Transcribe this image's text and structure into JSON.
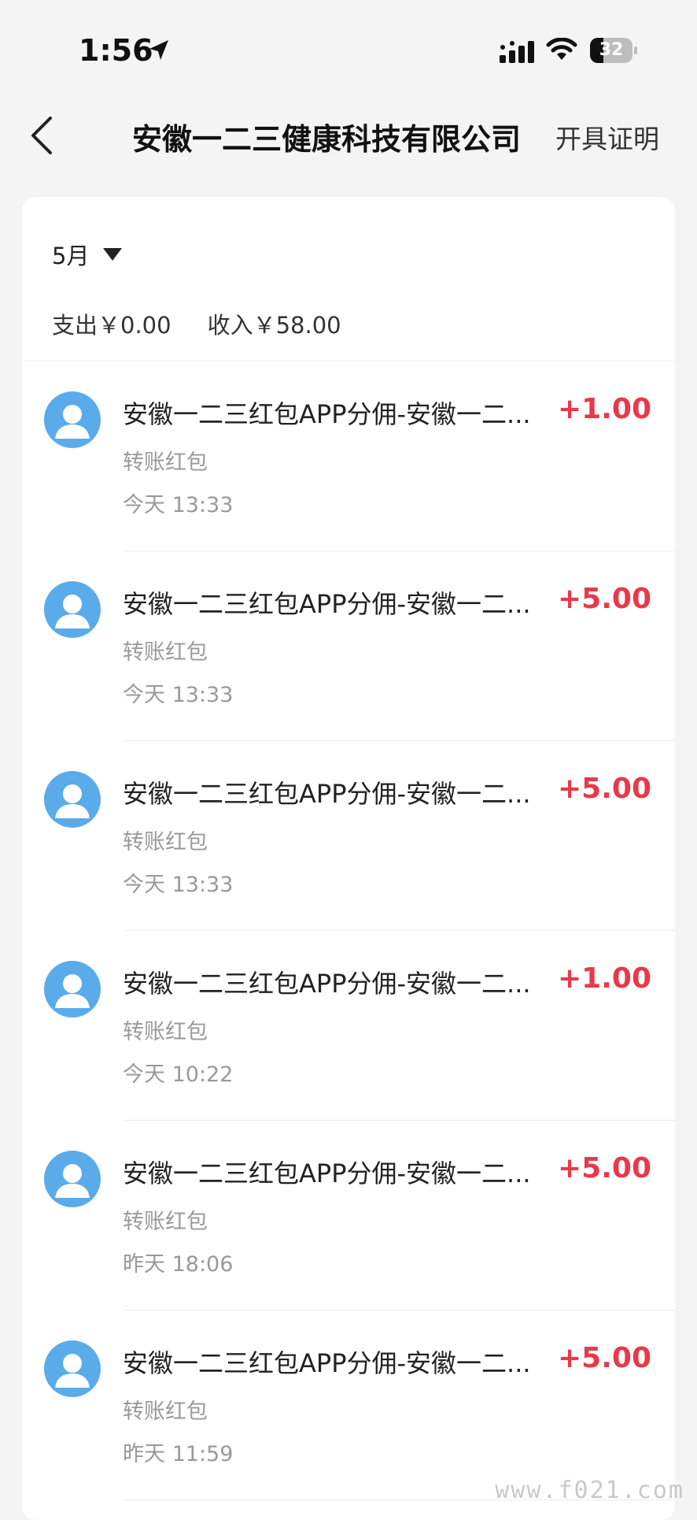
{
  "status_bar": {
    "time": "1:56",
    "battery_level": "32",
    "icons": [
      "location-arrow-icon",
      "cellular-signal-icon",
      "wifi-icon",
      "battery-icon"
    ]
  },
  "nav": {
    "back_icon": "chevron-left-icon",
    "title": "安徽一二三健康科技有限公司",
    "action": "开具证明"
  },
  "filter": {
    "month": "5月",
    "icon": "caret-down-icon"
  },
  "summary": {
    "expense": "支出￥0.00",
    "income": "收入￥58.00"
  },
  "transactions": [
    {
      "title": "安徽一二三红包APP分佣-安徽一二...",
      "type": "转账红包",
      "time": "今天 13:33",
      "amount": "+1.00"
    },
    {
      "title": "安徽一二三红包APP分佣-安徽一二...",
      "type": "转账红包",
      "time": "今天 13:33",
      "amount": "+5.00"
    },
    {
      "title": "安徽一二三红包APP分佣-安徽一二...",
      "type": "转账红包",
      "time": "今天 13:33",
      "amount": "+5.00"
    },
    {
      "title": "安徽一二三红包APP分佣-安徽一二...",
      "type": "转账红包",
      "time": "今天 10:22",
      "amount": "+1.00"
    },
    {
      "title": "安徽一二三红包APP分佣-安徽一二...",
      "type": "转账红包",
      "time": "昨天 18:06",
      "amount": "+5.00"
    },
    {
      "title": "安徽一二三红包APP分佣-安徽一二...",
      "type": "转账红包",
      "time": "昨天 11:59",
      "amount": "+5.00"
    }
  ],
  "watermark": "www.f021.com",
  "colors": {
    "background": "#f4f4f4",
    "card": "#ffffff",
    "amount_positive": "#e8394a",
    "avatar": "#5aabea",
    "secondary_text": "#999999"
  }
}
